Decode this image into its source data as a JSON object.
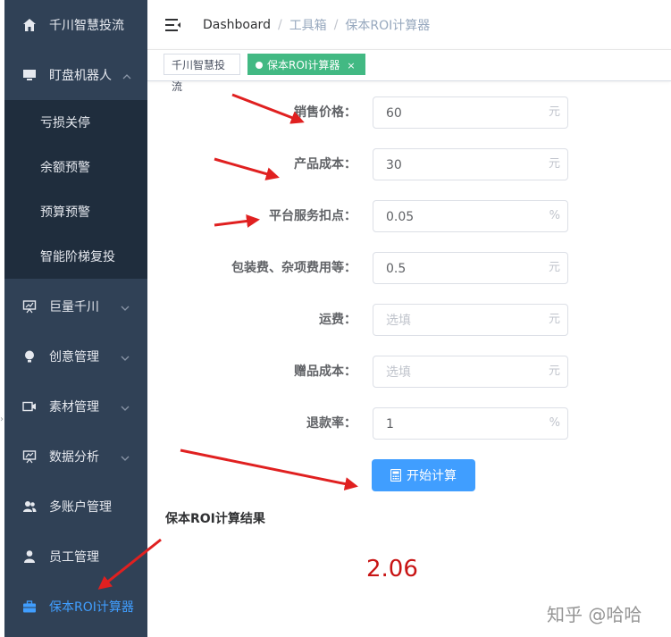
{
  "sidebar": {
    "items": [
      {
        "label": "千川智慧投流",
        "icon": "home-icon"
      },
      {
        "label": "盯盘机器人",
        "icon": "monitor-icon",
        "expanded": true,
        "children": [
          {
            "label": "亏损关停"
          },
          {
            "label": "余额预警"
          },
          {
            "label": "预算预警"
          },
          {
            "label": "智能阶梯复投"
          }
        ]
      },
      {
        "label": "巨量千川",
        "icon": "presentation-icon"
      },
      {
        "label": "创意管理",
        "icon": "bulb-icon"
      },
      {
        "label": "素材管理",
        "icon": "video-icon"
      },
      {
        "label": "数据分析",
        "icon": "chart-board-icon"
      },
      {
        "label": "多账户管理",
        "icon": "users-icon"
      },
      {
        "label": "员工管理",
        "icon": "user-icon"
      },
      {
        "label": "保本ROI计算器",
        "icon": "briefcase-icon",
        "active": true
      }
    ]
  },
  "header": {
    "breadcrumb": [
      "Dashboard",
      "工具箱",
      "保本ROI计算器"
    ]
  },
  "tags": [
    {
      "label": "千川智慧投流"
    },
    {
      "label": "保本ROI计算器",
      "active": true,
      "close": "×"
    }
  ],
  "form": {
    "fields": [
      {
        "label": "销售价格：",
        "value": "60",
        "placeholder": "",
        "suffix": "元"
      },
      {
        "label": "产品成本：",
        "value": "30",
        "placeholder": "",
        "suffix": "元"
      },
      {
        "label": "平台服务扣点：",
        "value": "0.05",
        "placeholder": "",
        "suffix": "%"
      },
      {
        "label": "包装费、杂项费用等：",
        "value": "0.5",
        "placeholder": "",
        "suffix": "元"
      },
      {
        "label": "运费：",
        "value": "",
        "placeholder": "选填",
        "suffix": "元"
      },
      {
        "label": "赠品成本：",
        "value": "",
        "placeholder": "选填",
        "suffix": "元"
      },
      {
        "label": "退款率：",
        "value": "1",
        "placeholder": "",
        "suffix": "%"
      }
    ],
    "submit_label": "开始计算"
  },
  "result": {
    "title": "保本ROI计算结果",
    "value": "2.06"
  },
  "watermark": "知乎 @哈哈",
  "colors": {
    "sidebar_bg": "#304156",
    "submenu_bg": "#1f2d3d",
    "accent": "#409eff",
    "tag_active": "#42b983",
    "result": "#c81414",
    "arrow": "#e02020"
  }
}
